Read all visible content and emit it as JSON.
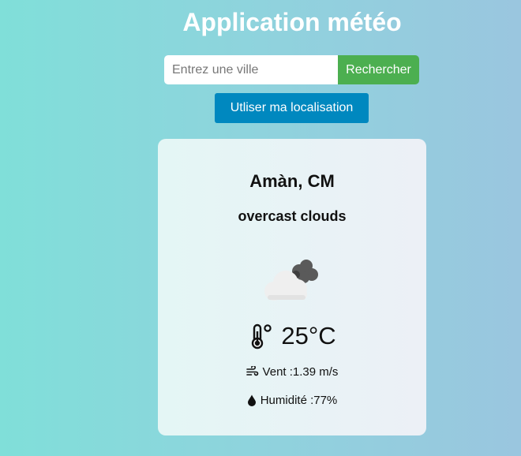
{
  "header": {
    "title": "Application météo"
  },
  "search": {
    "placeholder": "Entrez une ville",
    "button_label": "Rechercher"
  },
  "location_button_label": "Utliser ma localisation",
  "weather": {
    "city": "Amàn, CM",
    "description": "overcast clouds",
    "icon": "overcast-clouds-icon",
    "temperature": "25°C",
    "wind": "Vent :1.39 m/s",
    "humidity": "Humidité :77%"
  },
  "colors": {
    "search_button": "#4caf50",
    "location_button": "#0088bf",
    "title_text": "#ffffff"
  }
}
